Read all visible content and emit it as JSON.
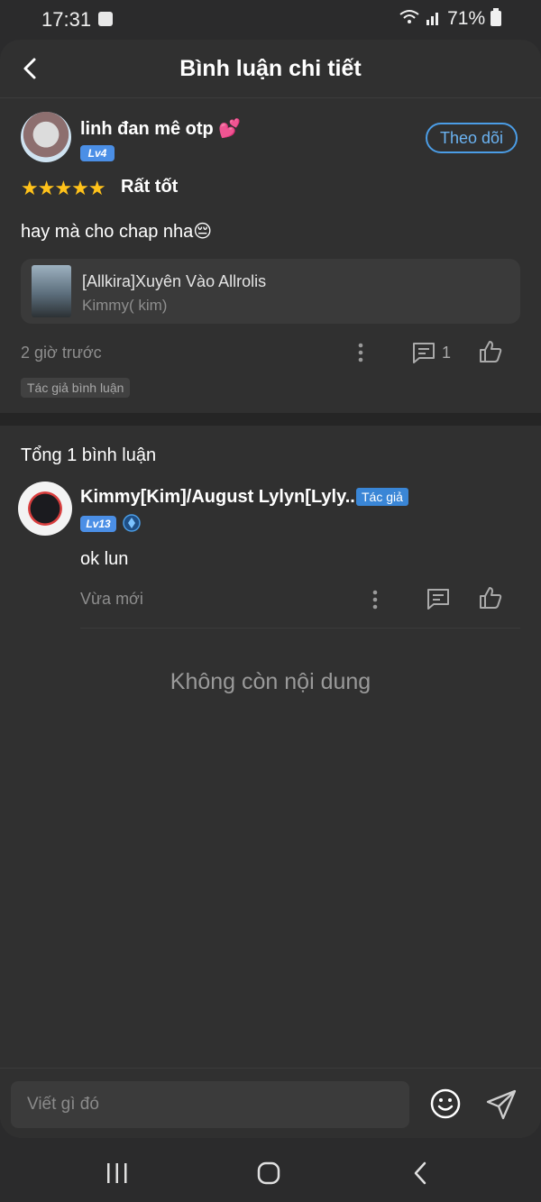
{
  "status_bar": {
    "time": "17:31",
    "battery": "71%"
  },
  "header": {
    "title": "Bình luận chi tiết"
  },
  "main_comment": {
    "username": "linh đan mê otp 💕",
    "level": "Lv4",
    "follow_label": "Theo dõi",
    "stars": "★★★★★",
    "rating_label": "Rất tốt",
    "text": "hay mà cho chap nha😔",
    "book": {
      "title": "[Allkira]Xuyên Vào Allrolis",
      "author": "Kimmy( kim)"
    },
    "time": "2 giờ trước",
    "reply_count": "1",
    "tag": "Tác giả bình luận"
  },
  "replies_section": {
    "total_label": "Tổng 1 bình luận",
    "replies": [
      {
        "username": "Kimmy[Kim]/August Lylyn[Lyly...",
        "author_tag": "Tác giả",
        "level": "Lv13",
        "text": "ok lun",
        "time": "Vừa mới"
      }
    ]
  },
  "empty_label": "Không còn nội dung",
  "composer": {
    "placeholder": "Viết gì đó"
  },
  "icons": {
    "back": "back-arrow-icon",
    "more": "more-vertical-icon",
    "reply": "comment-icon",
    "like": "thumbs-up-icon",
    "emoji": "smiley-icon",
    "send": "send-icon",
    "verified": "gem-icon"
  },
  "colors": {
    "accent": "#4b9de6",
    "star": "#ffc21a",
    "background": "#303030"
  }
}
